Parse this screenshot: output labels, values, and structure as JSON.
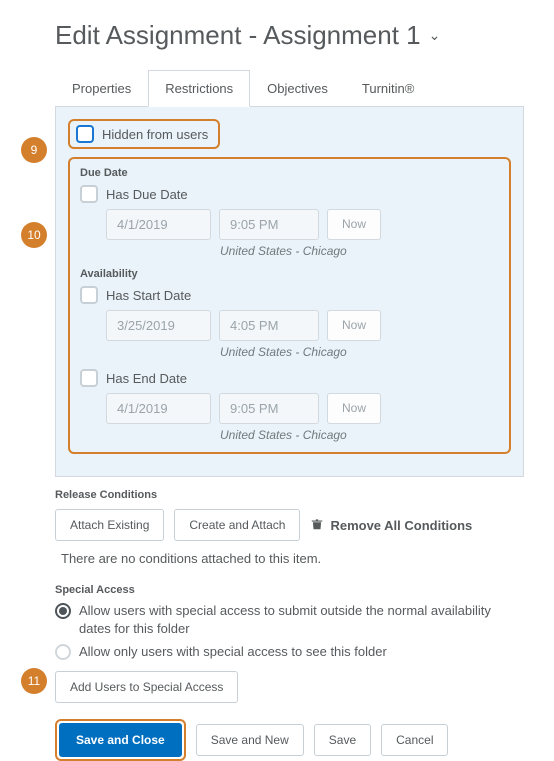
{
  "header": {
    "title": "Edit Assignment - Assignment 1"
  },
  "tabs": {
    "properties": "Properties",
    "restrictions": "Restrictions",
    "objectives": "Objectives",
    "turnitin": "Turnitin®"
  },
  "hidden": {
    "label": "Hidden from users"
  },
  "due": {
    "section_label": "Due Date",
    "has_due_label": "Has Due Date",
    "date": "4/1/2019",
    "time": "9:05 PM",
    "now": "Now",
    "tz": "United States - Chicago"
  },
  "availability": {
    "section_label": "Availability",
    "has_start_label": "Has Start Date",
    "start_date": "3/25/2019",
    "start_time": "4:05 PM",
    "start_now": "Now",
    "start_tz": "United States - Chicago",
    "has_end_label": "Has End Date",
    "end_date": "4/1/2019",
    "end_time": "9:05 PM",
    "end_now": "Now",
    "end_tz": "United States - Chicago"
  },
  "release": {
    "section_label": "Release Conditions",
    "attach_existing": "Attach Existing",
    "create_attach": "Create and Attach",
    "remove_all": "Remove All Conditions",
    "none_text": "There are no conditions attached to this item."
  },
  "special": {
    "section_label": "Special Access",
    "opt1": "Allow users with special access to submit outside the normal availability dates for this folder",
    "opt2": "Allow only users with special access to see this folder",
    "add_users": "Add Users to Special Access"
  },
  "footer": {
    "save_close": "Save and Close",
    "save_new": "Save and New",
    "save": "Save",
    "cancel": "Cancel"
  },
  "callouts": {
    "c9": "9",
    "c10": "10",
    "c11": "11"
  }
}
